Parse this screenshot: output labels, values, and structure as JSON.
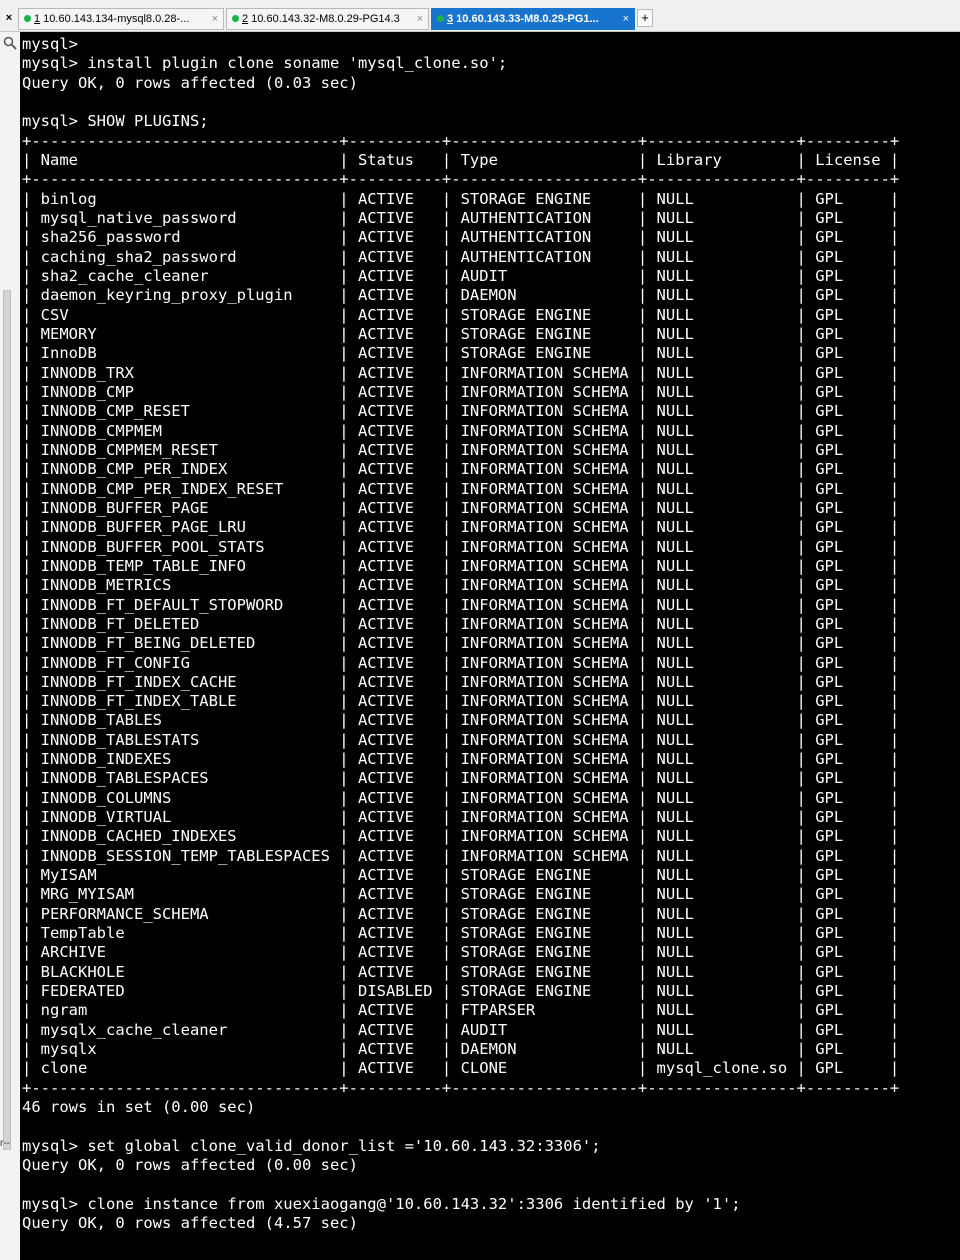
{
  "tabs": [
    {
      "num": "1",
      "label": " 10.60.143.134-mysql8.0.28-...",
      "active": false
    },
    {
      "num": "2",
      "label": " 10.60.143.32-M8.0.29-PG14.3",
      "active": false
    },
    {
      "num": "3",
      "label": " 10.60.143.33-M8.0.29-PG1...",
      "active": true
    }
  ],
  "tab_close_glyph": "×",
  "close_all_glyph": "×",
  "add_tab_glyph": "+",
  "gutter_mark": "r--",
  "icons": {
    "search": "search-icon",
    "status_dot": "green-dot-icon"
  },
  "colors": {
    "terminal_bg": "#000000",
    "terminal_fg": "#ffffff",
    "active_tab": "#1874cd",
    "status_dot": "#18b24a"
  },
  "terminal": {
    "pre_lines": [
      "mysql>",
      "mysql> install plugin clone soname 'mysql_clone.so';",
      "Query OK, 0 rows affected (0.03 sec)",
      "",
      "mysql> SHOW PLUGINS;"
    ],
    "columns": [
      "Name",
      "Status",
      "Type",
      "Library",
      "License"
    ],
    "rows": [
      [
        "binlog",
        "ACTIVE",
        "STORAGE ENGINE",
        "NULL",
        "GPL"
      ],
      [
        "mysql_native_password",
        "ACTIVE",
        "AUTHENTICATION",
        "NULL",
        "GPL"
      ],
      [
        "sha256_password",
        "ACTIVE",
        "AUTHENTICATION",
        "NULL",
        "GPL"
      ],
      [
        "caching_sha2_password",
        "ACTIVE",
        "AUTHENTICATION",
        "NULL",
        "GPL"
      ],
      [
        "sha2_cache_cleaner",
        "ACTIVE",
        "AUDIT",
        "NULL",
        "GPL"
      ],
      [
        "daemon_keyring_proxy_plugin",
        "ACTIVE",
        "DAEMON",
        "NULL",
        "GPL"
      ],
      [
        "CSV",
        "ACTIVE",
        "STORAGE ENGINE",
        "NULL",
        "GPL"
      ],
      [
        "MEMORY",
        "ACTIVE",
        "STORAGE ENGINE",
        "NULL",
        "GPL"
      ],
      [
        "InnoDB",
        "ACTIVE",
        "STORAGE ENGINE",
        "NULL",
        "GPL"
      ],
      [
        "INNODB_TRX",
        "ACTIVE",
        "INFORMATION SCHEMA",
        "NULL",
        "GPL"
      ],
      [
        "INNODB_CMP",
        "ACTIVE",
        "INFORMATION SCHEMA",
        "NULL",
        "GPL"
      ],
      [
        "INNODB_CMP_RESET",
        "ACTIVE",
        "INFORMATION SCHEMA",
        "NULL",
        "GPL"
      ],
      [
        "INNODB_CMPMEM",
        "ACTIVE",
        "INFORMATION SCHEMA",
        "NULL",
        "GPL"
      ],
      [
        "INNODB_CMPMEM_RESET",
        "ACTIVE",
        "INFORMATION SCHEMA",
        "NULL",
        "GPL"
      ],
      [
        "INNODB_CMP_PER_INDEX",
        "ACTIVE",
        "INFORMATION SCHEMA",
        "NULL",
        "GPL"
      ],
      [
        "INNODB_CMP_PER_INDEX_RESET",
        "ACTIVE",
        "INFORMATION SCHEMA",
        "NULL",
        "GPL"
      ],
      [
        "INNODB_BUFFER_PAGE",
        "ACTIVE",
        "INFORMATION SCHEMA",
        "NULL",
        "GPL"
      ],
      [
        "INNODB_BUFFER_PAGE_LRU",
        "ACTIVE",
        "INFORMATION SCHEMA",
        "NULL",
        "GPL"
      ],
      [
        "INNODB_BUFFER_POOL_STATS",
        "ACTIVE",
        "INFORMATION SCHEMA",
        "NULL",
        "GPL"
      ],
      [
        "INNODB_TEMP_TABLE_INFO",
        "ACTIVE",
        "INFORMATION SCHEMA",
        "NULL",
        "GPL"
      ],
      [
        "INNODB_METRICS",
        "ACTIVE",
        "INFORMATION SCHEMA",
        "NULL",
        "GPL"
      ],
      [
        "INNODB_FT_DEFAULT_STOPWORD",
        "ACTIVE",
        "INFORMATION SCHEMA",
        "NULL",
        "GPL"
      ],
      [
        "INNODB_FT_DELETED",
        "ACTIVE",
        "INFORMATION SCHEMA",
        "NULL",
        "GPL"
      ],
      [
        "INNODB_FT_BEING_DELETED",
        "ACTIVE",
        "INFORMATION SCHEMA",
        "NULL",
        "GPL"
      ],
      [
        "INNODB_FT_CONFIG",
        "ACTIVE",
        "INFORMATION SCHEMA",
        "NULL",
        "GPL"
      ],
      [
        "INNODB_FT_INDEX_CACHE",
        "ACTIVE",
        "INFORMATION SCHEMA",
        "NULL",
        "GPL"
      ],
      [
        "INNODB_FT_INDEX_TABLE",
        "ACTIVE",
        "INFORMATION SCHEMA",
        "NULL",
        "GPL"
      ],
      [
        "INNODB_TABLES",
        "ACTIVE",
        "INFORMATION SCHEMA",
        "NULL",
        "GPL"
      ],
      [
        "INNODB_TABLESTATS",
        "ACTIVE",
        "INFORMATION SCHEMA",
        "NULL",
        "GPL"
      ],
      [
        "INNODB_INDEXES",
        "ACTIVE",
        "INFORMATION SCHEMA",
        "NULL",
        "GPL"
      ],
      [
        "INNODB_TABLESPACES",
        "ACTIVE",
        "INFORMATION SCHEMA",
        "NULL",
        "GPL"
      ],
      [
        "INNODB_COLUMNS",
        "ACTIVE",
        "INFORMATION SCHEMA",
        "NULL",
        "GPL"
      ],
      [
        "INNODB_VIRTUAL",
        "ACTIVE",
        "INFORMATION SCHEMA",
        "NULL",
        "GPL"
      ],
      [
        "INNODB_CACHED_INDEXES",
        "ACTIVE",
        "INFORMATION SCHEMA",
        "NULL",
        "GPL"
      ],
      [
        "INNODB_SESSION_TEMP_TABLESPACES",
        "ACTIVE",
        "INFORMATION SCHEMA",
        "NULL",
        "GPL"
      ],
      [
        "MyISAM",
        "ACTIVE",
        "STORAGE ENGINE",
        "NULL",
        "GPL"
      ],
      [
        "MRG_MYISAM",
        "ACTIVE",
        "STORAGE ENGINE",
        "NULL",
        "GPL"
      ],
      [
        "PERFORMANCE_SCHEMA",
        "ACTIVE",
        "STORAGE ENGINE",
        "NULL",
        "GPL"
      ],
      [
        "TempTable",
        "ACTIVE",
        "STORAGE ENGINE",
        "NULL",
        "GPL"
      ],
      [
        "ARCHIVE",
        "ACTIVE",
        "STORAGE ENGINE",
        "NULL",
        "GPL"
      ],
      [
        "BLACKHOLE",
        "ACTIVE",
        "STORAGE ENGINE",
        "NULL",
        "GPL"
      ],
      [
        "FEDERATED",
        "DISABLED",
        "STORAGE ENGINE",
        "NULL",
        "GPL"
      ],
      [
        "ngram",
        "ACTIVE",
        "FTPARSER",
        "NULL",
        "GPL"
      ],
      [
        "mysqlx_cache_cleaner",
        "ACTIVE",
        "AUDIT",
        "NULL",
        "GPL"
      ],
      [
        "mysqlx",
        "ACTIVE",
        "DAEMON",
        "NULL",
        "GPL"
      ],
      [
        "clone",
        "ACTIVE",
        "CLONE",
        "mysql_clone.so",
        "GPL"
      ]
    ],
    "post_lines": [
      "46 rows in set (0.00 sec)",
      "",
      "mysql> set global clone_valid_donor_list ='10.60.143.32:3306';",
      "Query OK, 0 rows affected (0.00 sec)",
      "",
      "mysql> clone instance from xuexiaogang@'10.60.143.32':3306 identified by '1';",
      "Query OK, 0 rows affected (4.57 sec)"
    ]
  }
}
